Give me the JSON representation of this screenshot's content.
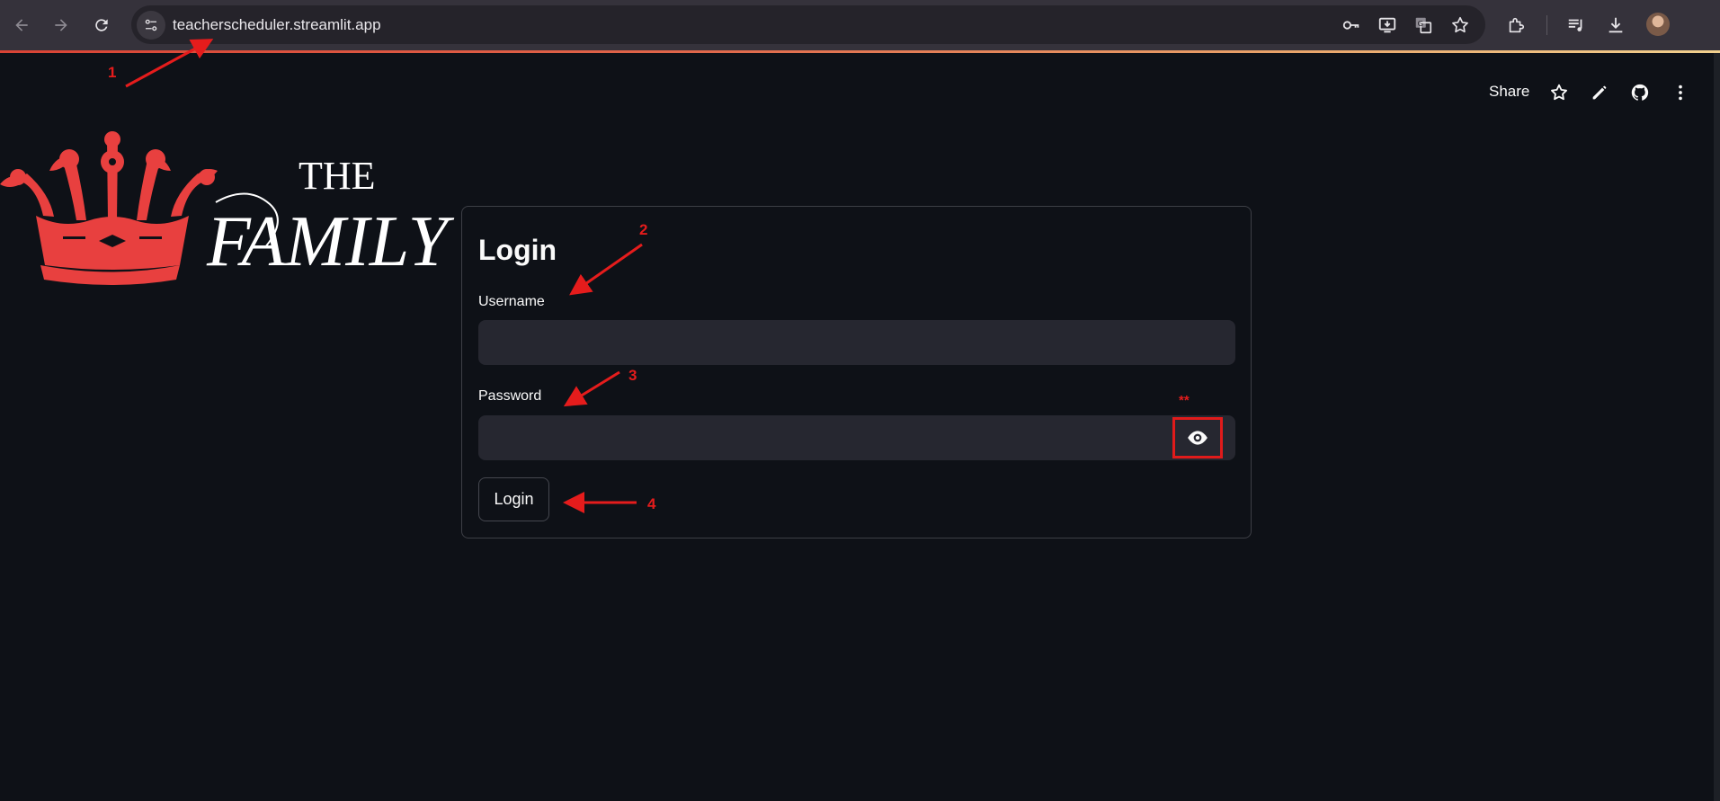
{
  "browser": {
    "url": "teacherscheduler.streamlit.app",
    "nav_icons": [
      "back-arrow-icon",
      "forward-arrow-icon",
      "reload-icon"
    ],
    "omnibox_icons": [
      "password-key-icon",
      "install-app-icon",
      "translate-icon",
      "bookmark-star-icon"
    ],
    "toolbar_icons": [
      "extensions-icon",
      "media-control-icon",
      "downloads-icon",
      "profile-avatar"
    ]
  },
  "app_header": {
    "share_label": "Share",
    "icons": [
      "star-icon",
      "edit-pencil-icon",
      "github-icon",
      "more-vert-icon"
    ]
  },
  "logo": {
    "line1": "THE",
    "line2": "FAMILY",
    "crown_color": "#e8403f"
  },
  "login_form": {
    "title": "Login",
    "username_label": "Username",
    "username_value": "",
    "password_label": "Password",
    "password_value": "",
    "show_password_icon": "eye-icon",
    "submit_label": "Login"
  },
  "annotations": {
    "color": "#e51c1c",
    "labels": [
      "1",
      "2",
      "3",
      "4",
      "**"
    ]
  }
}
